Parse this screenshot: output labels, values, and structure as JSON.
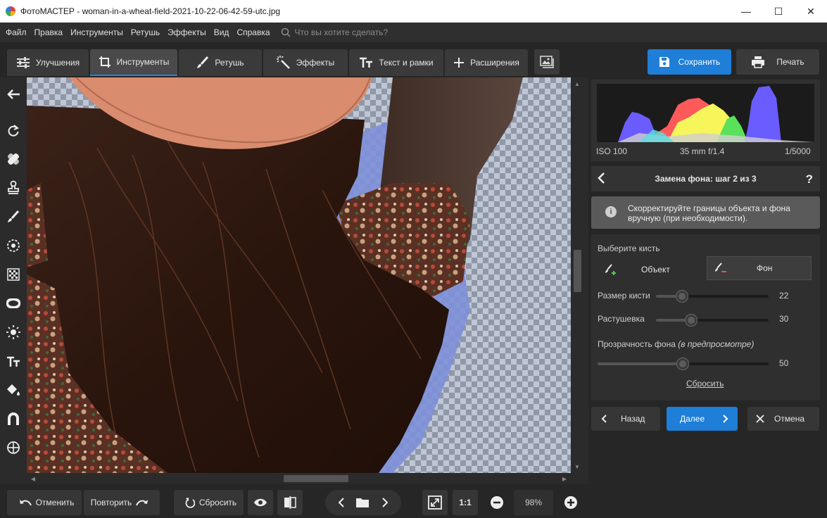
{
  "window": {
    "title": "ФотоМАСТЕР - woman-in-a-wheat-field-2021-10-22-06-42-59-utc.jpg",
    "minimize": "—",
    "maximize": "☐",
    "close": "✕"
  },
  "menu": {
    "items": [
      "Файл",
      "Правка",
      "Инструменты",
      "Ретушь",
      "Эффекты",
      "Вид",
      "Справка"
    ],
    "search_placeholder": "Что вы хотите сделать?"
  },
  "tabs": [
    {
      "label": "Улучшения",
      "icon": "sliders-icon"
    },
    {
      "label": "Инструменты",
      "icon": "crop-icon",
      "active": true
    },
    {
      "label": "Ретушь",
      "icon": "brush-icon"
    },
    {
      "label": "Эффекты",
      "icon": "magic-wand-icon"
    },
    {
      "label": "Текст и рамки",
      "icon": "text-icon"
    },
    {
      "label": "Расширения",
      "icon": "plus-icon"
    }
  ],
  "toolbar": {
    "save_label": "Сохранить",
    "print_label": "Печать"
  },
  "left_tools": [
    "back-arrow-icon",
    "rotate-icon",
    "healing-icon",
    "stamp-icon",
    "brush-icon",
    "target-icon",
    "gradient-icon",
    "ellipse-icon",
    "sun-icon",
    "text-icon",
    "fill-icon",
    "magnet-icon",
    "globe-icon"
  ],
  "bottom": {
    "undo_label": "Отменить",
    "redo_label": "Повторить",
    "reset_label": "Сбросить",
    "fit_label": "1:1",
    "zoom": "98%"
  },
  "histogram": {
    "iso": "ISO 100",
    "lens": "35 mm f/1.4",
    "shutter": "1/5000"
  },
  "step": {
    "title": "Замена фона: шаг 2 из 3",
    "help": "?",
    "info": "Скорректируйте границы объекта и фона вручную (при необходимости)."
  },
  "brush": {
    "section_label": "Выберите кисть",
    "object_label": "Объект",
    "background_label": "Фон",
    "size_label": "Размер кисти",
    "size_value": 22,
    "feather_label": "Растушевка",
    "feather_value": 30,
    "opacity_label": "Прозрачность фона",
    "opacity_note": "(в предпросмотре)",
    "opacity_value": 50,
    "reset_link": "Сбросить"
  },
  "nav": {
    "back_label": "Назад",
    "next_label": "Далее",
    "cancel_label": "Отмена"
  },
  "colors": {
    "accent": "#1e7ed8",
    "panel": "#2f2f2f",
    "background": "#262626"
  }
}
